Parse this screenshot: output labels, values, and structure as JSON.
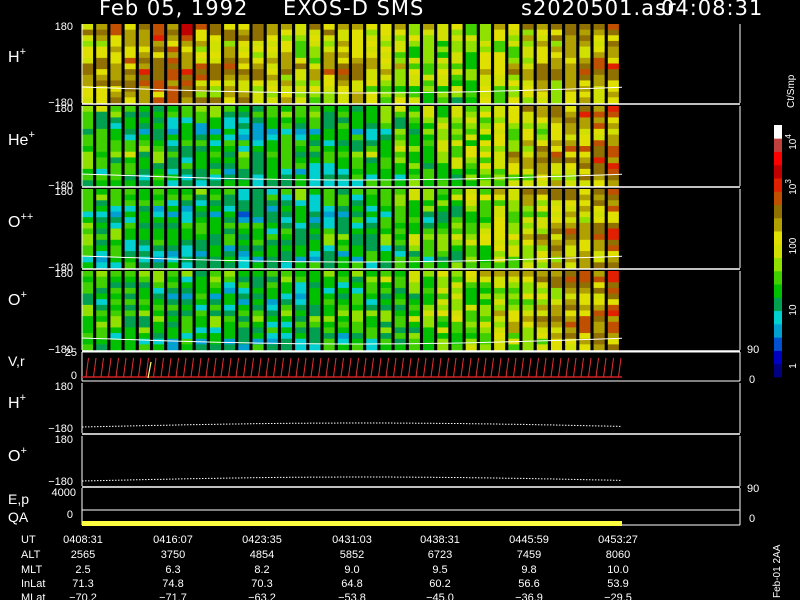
{
  "header": {
    "date": "Feb 05, 1992",
    "instrument": "EXOS-D SMS",
    "file": "s2020501.asr",
    "time": "04:08:31"
  },
  "chart_data": [
    {
      "type": "heatmap",
      "panels": [
        {
          "label": "H",
          "superscript": "+",
          "y_top": "180",
          "y_bottom": "-180",
          "intensity": 0.62
        },
        {
          "label": "He",
          "superscript": "+",
          "y_top": "180",
          "y_bottom": "-180",
          "intensity": 0.4
        },
        {
          "label": "O",
          "superscript": "++",
          "y_top": "180",
          "y_bottom": "-180",
          "intensity": 0.38
        },
        {
          "label": "O",
          "superscript": "+",
          "y_top": "180",
          "y_bottom": "-180",
          "intensity": 0.4
        }
      ],
      "colorbar": {
        "unit": "Ct/Smp",
        "tick_labels": [
          "1",
          "10",
          "100",
          "10",
          "10"
        ],
        "tick_exponents": [
          "",
          "",
          "",
          "3",
          "4"
        ],
        "colors": [
          "#000080",
          "#0000c0",
          "#0050d0",
          "#00a0d0",
          "#00d0d0",
          "#00a050",
          "#00c000",
          "#40d000",
          "#90e000",
          "#d0e000",
          "#e0e000",
          "#b0a000",
          "#907000",
          "#c05000",
          "#e02000",
          "#c00000",
          "#ff0000",
          "#c04040",
          "#ffffff"
        ]
      }
    },
    {
      "type": "line",
      "label": "V,r",
      "y_top": "25",
      "y_zero": "0",
      "right_top": "90",
      "right_zero": "0"
    },
    {
      "type": "line",
      "panels": [
        {
          "label": "H",
          "superscript": "+",
          "y_top": "180",
          "y_bottom": "-180"
        },
        {
          "label": "O",
          "superscript": "+",
          "y_top": "180",
          "y_bottom": "-180"
        }
      ]
    },
    {
      "type": "line",
      "labels": [
        "E,p",
        "QA"
      ],
      "y_top": "4000",
      "y_zero": "0",
      "right_top": "90",
      "right_zero": "0"
    }
  ],
  "footer": {
    "row_labels": [
      "UT",
      "ALT",
      "MLT",
      "InLat",
      "MLat"
    ],
    "columns": [
      [
        "0408:31",
        "2565",
        "2.5",
        "71.3",
        "-70.2"
      ],
      [
        "0416:07",
        "3750",
        "6.3",
        "74.8",
        "-71.7"
      ],
      [
        "0423:35",
        "4854",
        "8.2",
        "70.3",
        "-63.2"
      ],
      [
        "0431:03",
        "5852",
        "9.0",
        "64.8",
        "-53.8"
      ],
      [
        "0438:31",
        "6723",
        "9.5",
        "60.2",
        "-45.0"
      ],
      [
        "0445:59",
        "7459",
        "9.8",
        "56.6",
        "-36.9"
      ],
      [
        "0453:27",
        "8060",
        "10.0",
        "53.9",
        "-29.5"
      ]
    ],
    "stamp": "Feb-01 2AA"
  }
}
